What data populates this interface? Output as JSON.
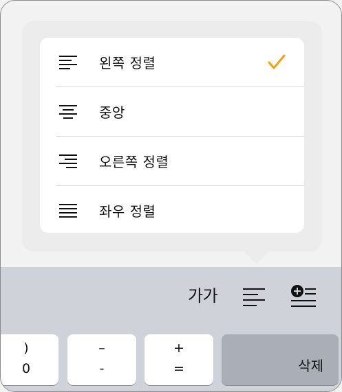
{
  "align_menu": {
    "items": [
      {
        "label": "왼쪽 정렬",
        "icon": "align-left-icon",
        "selected": true
      },
      {
        "label": "중앙",
        "icon": "align-center-icon",
        "selected": false
      },
      {
        "label": "오른쪽 정렬",
        "icon": "align-right-icon",
        "selected": false
      },
      {
        "label": "좌우 정렬",
        "icon": "align-justify-icon",
        "selected": false
      }
    ],
    "check_color": "#f5a010"
  },
  "toolbar": {
    "font_style_label": "가가",
    "icons": [
      "align-left-icon",
      "insert-list-icon"
    ]
  },
  "keyboard": {
    "keys": [
      {
        "top": ")",
        "bottom": "0"
      },
      {
        "top": "–",
        "bottom": "-"
      },
      {
        "top": "+",
        "bottom": "="
      }
    ],
    "delete_label": "삭제"
  }
}
